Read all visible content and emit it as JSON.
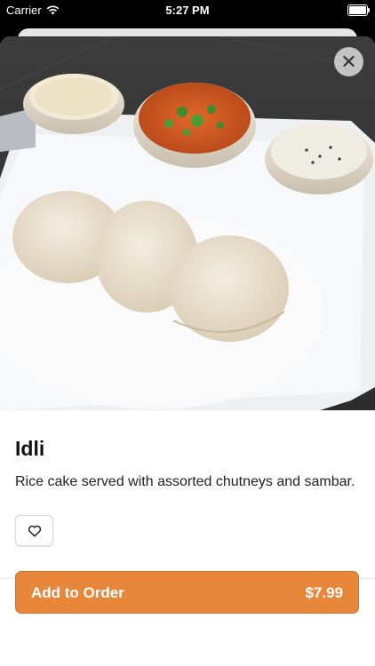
{
  "status": {
    "carrier": "Carrier",
    "time": "5:27 PM"
  },
  "item": {
    "name": "Idli",
    "description": "Rice cake served with assorted chutneys and sambar."
  },
  "order": {
    "label": "Add to Order",
    "price": "$7.99"
  },
  "icons": {
    "close": "close-icon",
    "favorite": "heart-icon",
    "wifi": "wifi-icon",
    "battery": "battery-icon"
  },
  "colors": {
    "accent": "#e8873a",
    "text": "#111111"
  }
}
